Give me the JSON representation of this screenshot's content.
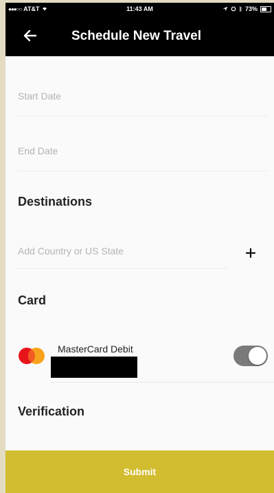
{
  "status_bar": {
    "carrier": "AT&T",
    "time": "11:43 AM",
    "battery": "73%",
    "battery_level": 0.73
  },
  "header": {
    "title": "Schedule New Travel",
    "back_icon": "arrow-left-icon"
  },
  "form": {
    "start_date": {
      "placeholder": "Start Date",
      "value": ""
    },
    "end_date": {
      "placeholder": "End Date",
      "value": ""
    },
    "destinations": {
      "label": "Destinations",
      "input_placeholder": "Add Country or US State",
      "add_icon": "plus-icon"
    },
    "card": {
      "label": "Card",
      "items": [
        {
          "name": "MasterCard Debit",
          "brand_icon": "mastercard-icon",
          "enabled": true
        }
      ]
    },
    "verification": {
      "label": "Verification"
    }
  },
  "footer": {
    "submit_label": "Submit"
  },
  "colors": {
    "header_bg": "#000000",
    "submit_bg": "#d2bc2f",
    "toggle_on": "#7a7a7a",
    "placeholder_text": "#b3b3b3"
  }
}
